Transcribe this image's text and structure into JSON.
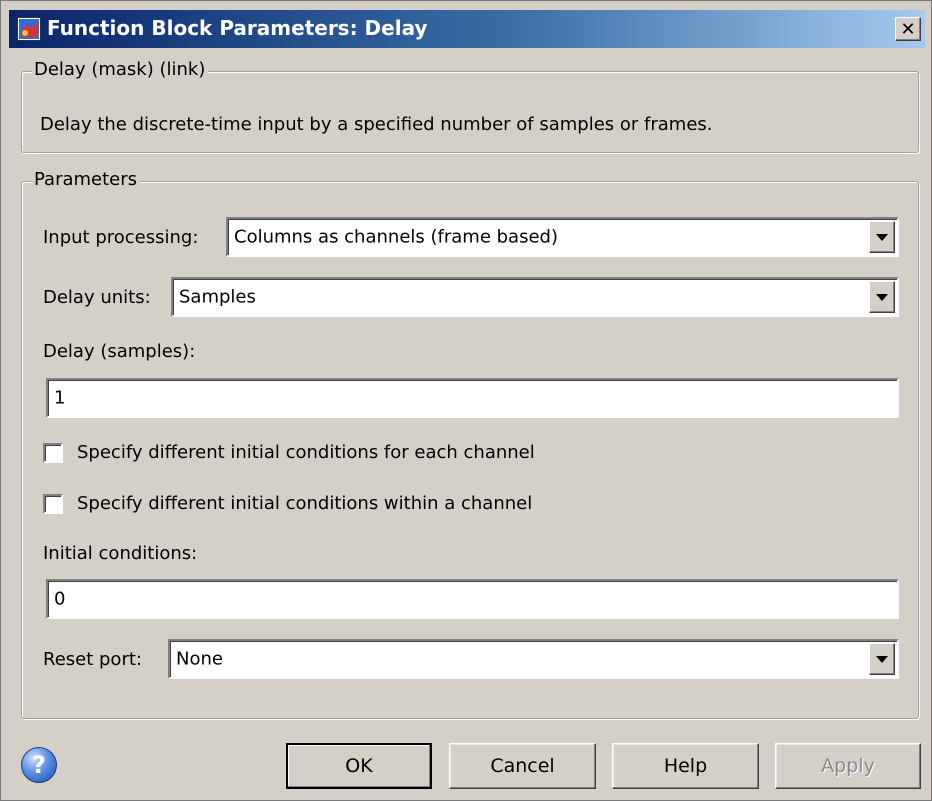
{
  "window": {
    "title": "Function Block Parameters: Delay",
    "close_label": "✕"
  },
  "description_group": {
    "legend": "Delay (mask) (link)",
    "text": "Delay the discrete-time input by a specified number of samples or frames."
  },
  "parameters_group": {
    "legend": "Parameters",
    "input_processing": {
      "label": "Input processing:",
      "value": "Columns as channels (frame based)"
    },
    "delay_units": {
      "label": "Delay units:",
      "value": "Samples"
    },
    "delay_samples": {
      "label": "Delay (samples):",
      "value": "1"
    },
    "check_each_channel": {
      "label": "Specify different initial conditions for each channel",
      "checked": false
    },
    "check_within_channel": {
      "label": "Specify different initial conditions within a channel",
      "checked": false
    },
    "initial_conditions": {
      "label": "Initial conditions:",
      "value": "0"
    },
    "reset_port": {
      "label": "Reset port:",
      "value": "None"
    }
  },
  "buttons": {
    "ok": "OK",
    "cancel": "Cancel",
    "help": "Help",
    "apply": "Apply"
  },
  "icons": {
    "app": "simulink-block-icon",
    "help": "help-question-icon",
    "help_glyph": "?"
  }
}
